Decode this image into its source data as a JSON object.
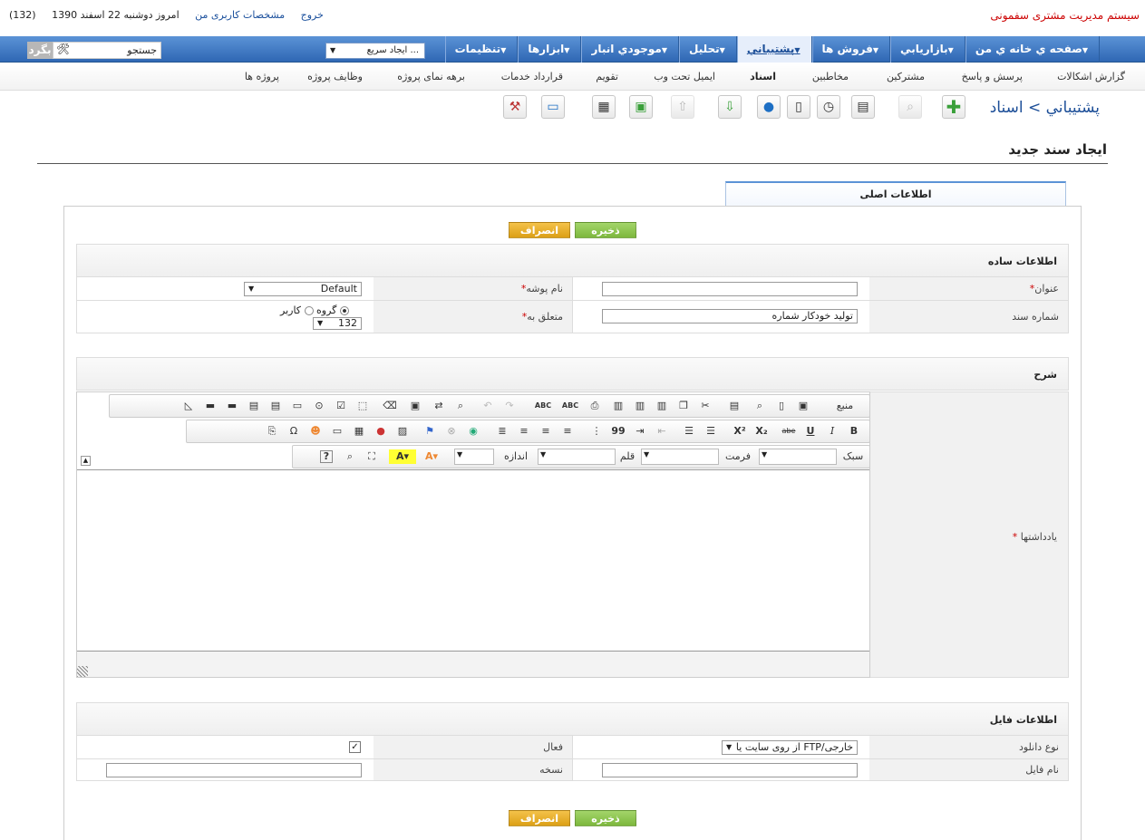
{
  "header": {
    "app_name": "سیستم مدیریت مشتری سفمونی",
    "date_text": "امروز دوشنبه 22 اسفند 1390",
    "profile_link": "مشخصات کاربری من",
    "logout_link": "خروج",
    "badge_count": "(132)"
  },
  "main_nav": {
    "items": [
      {
        "label": "صفحه ي خانه ي من",
        "dropdown": true
      },
      {
        "label": "بازاريابي",
        "dropdown": true
      },
      {
        "label": "فروش ها",
        "dropdown": true
      },
      {
        "label": "پشتيباني",
        "dropdown": true,
        "active": true
      },
      {
        "label": "تحليل",
        "dropdown": true
      },
      {
        "label": "موجودي انبار",
        "dropdown": true
      },
      {
        "label": "ابزارها",
        "dropdown": true
      },
      {
        "label": "تنظیمات",
        "dropdown": true
      }
    ],
    "quick_create": "ایجاد سریع ...",
    "search_value": "جستجو",
    "search_button": "بگرد"
  },
  "sub_nav": {
    "items": [
      "گزارش اشکالات",
      "پرسش و پاسخ",
      "مشترکین",
      "مخاطبين",
      "اسناد",
      "ایمیل تحت وب",
      "تقویم",
      "قرارداد خدمات",
      "برهه نمای پروژه",
      "وظایف پروژه",
      "پروژه ها"
    ],
    "current": "اسناد"
  },
  "breadcrumb": {
    "parent": "پشتيباني",
    "separator": ">",
    "current": "اسناد"
  },
  "toolbar_icons": [
    "add-icon",
    "search-icon",
    "calendar-icon",
    "clock-icon",
    "calculator-icon",
    "chat-icon",
    "import-icon",
    "export-icon",
    "add-file-icon",
    "preview-icon",
    "monitor-icon",
    "settings-icon"
  ],
  "page": {
    "title": "ایجاد سند جدید",
    "tab": "اطلاعات اصلی"
  },
  "buttons": {
    "save": "ذخیره",
    "cancel": "انصراف"
  },
  "basic_info": {
    "title": "اطلاعات ساده",
    "title_label": "عنوان",
    "title_value": "",
    "folder_label": "نام پوشه",
    "folder_value": "Default",
    "docnum_label": "شماره سند",
    "docnum_value": "تولید خودکار شماره",
    "assigned_label": "متعلق به",
    "assign_user": "کاربر",
    "assign_group": "گروه",
    "assign_value": "132"
  },
  "description": {
    "title": "شرح",
    "notes_label": "یادداشتها",
    "style_label": "سبک",
    "format_label": "فرمت",
    "font_label": "قلم",
    "size_label": "اندازه",
    "source_label": "منبع",
    "abc_label": "ABC",
    "x2_label": "X²",
    "x_sub_label": "X₂",
    "abe_label": "abe",
    "u_label": "U",
    "i_label": "I",
    "b_label": "B",
    "quote_label": "99",
    "help_label": "?"
  },
  "file_info": {
    "title": "اطلاعات فایل",
    "download_type_label": "نوع دانلود",
    "download_type_value": "از روی سایت یا FTP/خارجی",
    "active_label": "فعال",
    "active_checked": true,
    "filename_label": "نام فایل",
    "version_label": "نسخه"
  },
  "colors": {
    "nav_blue": "#2f67b4",
    "brand_red": "#cc0000",
    "save_green": "#7db83d",
    "cancel_orange": "#dca016"
  }
}
